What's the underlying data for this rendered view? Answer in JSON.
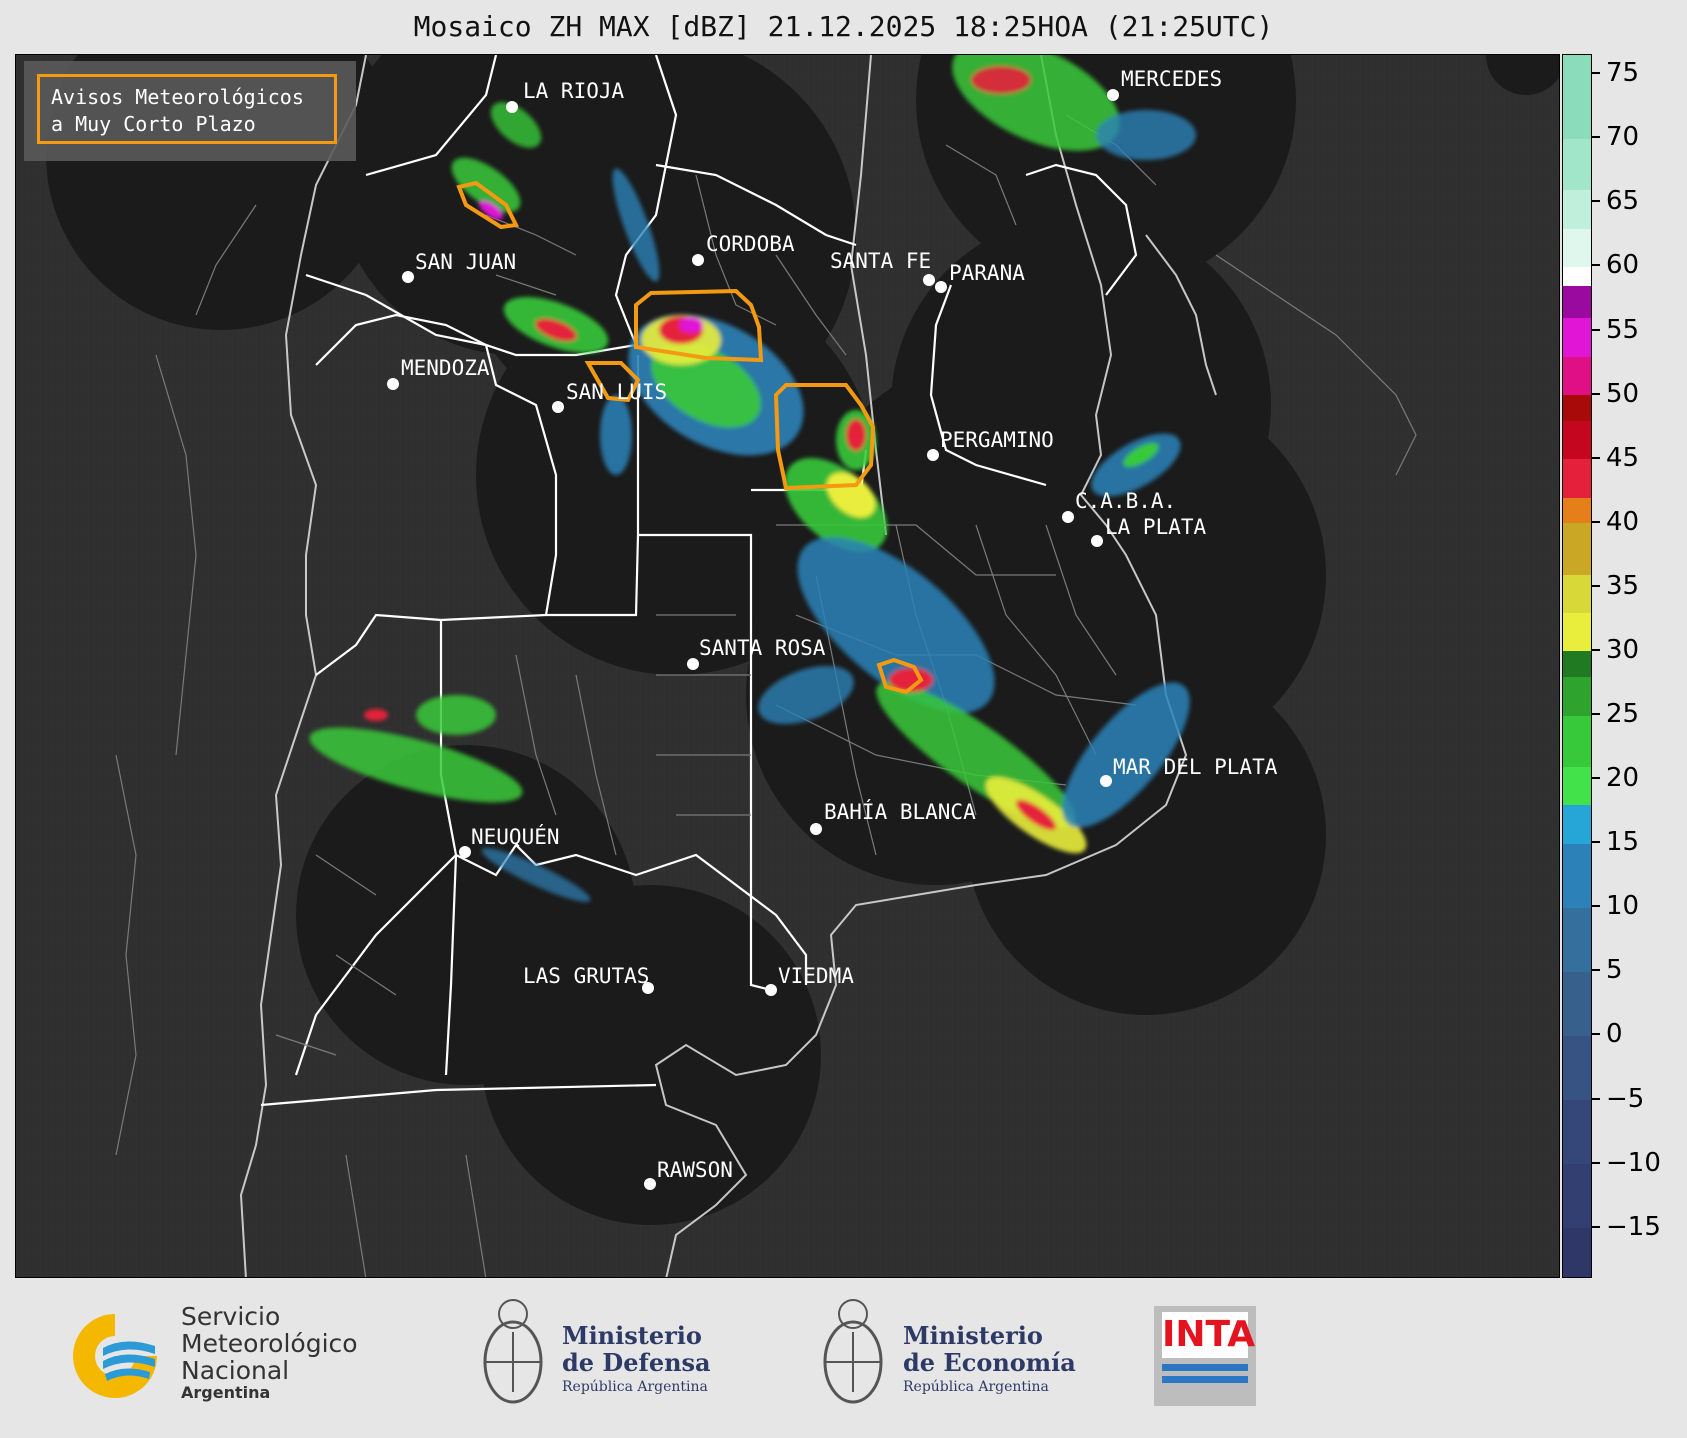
{
  "title": "Mosaico ZH MAX [dBZ] 21.12.2025 18:25HOA (21:25UTC)",
  "legend": {
    "line1": "Avisos Meteorológicos",
    "line2": "a Muy Corto Plazo",
    "outline_color": "#f39a12"
  },
  "cities": [
    {
      "name": "LA RIOJA"
    },
    {
      "name": "MERCEDES"
    },
    {
      "name": "SAN JUAN"
    },
    {
      "name": "CORDOBA"
    },
    {
      "name": "SANTA FE"
    },
    {
      "name": "PARANA"
    },
    {
      "name": "MENDOZA"
    },
    {
      "name": "SAN LUIS"
    },
    {
      "name": "PERGAMINO"
    },
    {
      "name": "C.A.B.A."
    },
    {
      "name": "LA PLATA"
    },
    {
      "name": "SANTA ROSA"
    },
    {
      "name": "MAR DEL PLATA"
    },
    {
      "name": "BAHÍA BLANCA"
    },
    {
      "name": "NEUQUÉN"
    },
    {
      "name": "LAS GRUTAS"
    },
    {
      "name": "VIEDMA"
    },
    {
      "name": "RAWSON"
    }
  ],
  "colorbar": {
    "unit": "dBZ",
    "min": -19,
    "max": 76.5,
    "ticks": [
      "75",
      "70",
      "65",
      "60",
      "55",
      "50",
      "45",
      "40",
      "35",
      "30",
      "25",
      "20",
      "15",
      "10",
      "5",
      "0",
      "−5",
      "−10",
      "−15"
    ],
    "tick_values": [
      75,
      70,
      65,
      60,
      55,
      50,
      45,
      40,
      35,
      30,
      25,
      20,
      15,
      10,
      5,
      0,
      -5,
      -10,
      -15
    ],
    "bands": [
      {
        "from": -19,
        "to": -15,
        "color": "#2e3768"
      },
      {
        "from": -15,
        "to": -10,
        "color": "#323f70"
      },
      {
        "from": -10,
        "to": -5,
        "color": "#354779"
      },
      {
        "from": -5,
        "to": 0,
        "color": "#365383"
      },
      {
        "from": 0,
        "to": 5,
        "color": "#37608d"
      },
      {
        "from": 5,
        "to": 10,
        "color": "#356f9e"
      },
      {
        "from": 10,
        "to": 15,
        "color": "#2c82b8"
      },
      {
        "from": 15,
        "to": 18,
        "color": "#26a6d6"
      },
      {
        "from": 18,
        "to": 21,
        "color": "#42e34a"
      },
      {
        "from": 21,
        "to": 25,
        "color": "#38c93a"
      },
      {
        "from": 25,
        "to": 28,
        "color": "#2ea32e"
      },
      {
        "from": 28,
        "to": 30,
        "color": "#1f7a22"
      },
      {
        "from": 30,
        "to": 33,
        "color": "#e9ee3c"
      },
      {
        "from": 33,
        "to": 36,
        "color": "#d8d838"
      },
      {
        "from": 36,
        "to": 40,
        "color": "#caa826"
      },
      {
        "from": 40,
        "to": 42,
        "color": "#e57f1a"
      },
      {
        "from": 42,
        "to": 45,
        "color": "#e5203b"
      },
      {
        "from": 45,
        "to": 48,
        "color": "#c4061e"
      },
      {
        "from": 48,
        "to": 50,
        "color": "#a80a0a"
      },
      {
        "from": 50,
        "to": 53,
        "color": "#e00f86"
      },
      {
        "from": 53,
        "to": 56,
        "color": "#e015d6"
      },
      {
        "from": 56,
        "to": 58.5,
        "color": "#9b0a9e"
      },
      {
        "from": 58.5,
        "to": 60,
        "color": "#ffffff"
      },
      {
        "from": 60,
        "to": 63,
        "color": "#dff7ec"
      },
      {
        "from": 63,
        "to": 66,
        "color": "#c0efdb"
      },
      {
        "from": 66,
        "to": 70,
        "color": "#a2e6c9"
      },
      {
        "from": 70,
        "to": 76.5,
        "color": "#8adcba"
      }
    ]
  },
  "logos": {
    "smn_line1": "Servicio",
    "smn_line2": "Meteorológico",
    "smn_line3": "Nacional",
    "smn_line4": "Argentina",
    "defensa_line1": "Ministerio",
    "defensa_line2": "de Defensa",
    "defensa_line3": "República Argentina",
    "economia_line1": "Ministerio",
    "economia_line2": "de Economía",
    "economia_line3": "República Argentina",
    "inta": "INTA"
  }
}
